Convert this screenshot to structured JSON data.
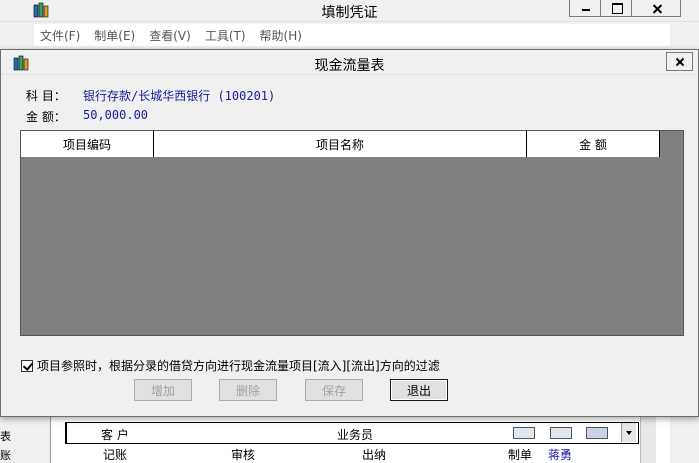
{
  "background_window": {
    "title": "填制凭证",
    "menu": [
      "文件(F)",
      "制单(E)",
      "查看(V)",
      "工具(T)",
      "帮助(H)"
    ],
    "left_strip": [
      "表",
      "账"
    ],
    "form": {
      "customer_label": "客 户",
      "salesperson_label": "业务员",
      "bookkeeping_label": "记账",
      "review_label": "审核",
      "cashier_label": "出纳",
      "prepared_by_label": "制单",
      "prepared_by_value": "蒋勇"
    }
  },
  "dialog": {
    "title": "现金流量表",
    "subject_label": "科 目：",
    "subject_value": "银行存款/长城华西银行 (100201)",
    "amount_label": "金 额：",
    "amount_value": "50,000.00",
    "table": {
      "columns": [
        "项目编码",
        "项目名称",
        "金 额"
      ],
      "rows": []
    },
    "filter_checkbox": {
      "checked": true,
      "label": "项目参照时，根据分录的借贷方向进行现金流量项目[流入][流出]方向的过滤"
    },
    "buttons": {
      "add": "增加",
      "delete": "删除",
      "save": "保存",
      "exit": "退出"
    }
  },
  "colors": {
    "window_bg": "#f0f0f0",
    "grid_bg": "#808080",
    "value_text": "#1a1a9c"
  }
}
